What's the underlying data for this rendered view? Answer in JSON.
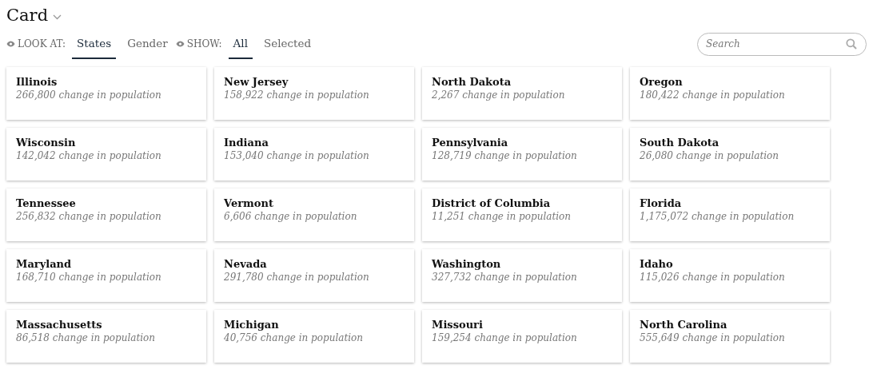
{
  "title": "Card",
  "look_at": {
    "label": "LOOK AT:",
    "tabs": [
      {
        "label": "States",
        "selected": true
      },
      {
        "label": "Gender",
        "selected": false
      }
    ]
  },
  "show": {
    "label": "SHOW:",
    "tabs": [
      {
        "label": "All",
        "selected": true
      },
      {
        "label": "Selected",
        "selected": false
      }
    ]
  },
  "search": {
    "placeholder": "Search"
  },
  "cards": [
    {
      "name": "Illinois",
      "detail": "266,800 change in population"
    },
    {
      "name": "New Jersey",
      "detail": "158,922 change in population"
    },
    {
      "name": "North Dakota",
      "detail": "2,267 change in population"
    },
    {
      "name": "Oregon",
      "detail": "180,422 change in population"
    },
    {
      "name": "Wisconsin",
      "detail": "142,042 change in population"
    },
    {
      "name": "Indiana",
      "detail": "153,040 change in population"
    },
    {
      "name": "Pennsylvania",
      "detail": "128,719 change in population"
    },
    {
      "name": "South Dakota",
      "detail": "26,080 change in population"
    },
    {
      "name": "Tennessee",
      "detail": "256,832 change in population"
    },
    {
      "name": "Vermont",
      "detail": "6,606 change in population"
    },
    {
      "name": "District of Columbia",
      "detail": "11,251 change in population"
    },
    {
      "name": "Florida",
      "detail": "1,175,072 change in population"
    },
    {
      "name": "Maryland",
      "detail": "168,710 change in population"
    },
    {
      "name": "Nevada",
      "detail": "291,780 change in population"
    },
    {
      "name": "Washington",
      "detail": "327,732 change in population"
    },
    {
      "name": "Idaho",
      "detail": "115,026 change in population"
    },
    {
      "name": "Massachusetts",
      "detail": "86,518 change in population"
    },
    {
      "name": "Michigan",
      "detail": "40,756 change in population"
    },
    {
      "name": "Missouri",
      "detail": "159,254 change in population"
    },
    {
      "name": "North Carolina",
      "detail": "555,649 change in population"
    }
  ]
}
